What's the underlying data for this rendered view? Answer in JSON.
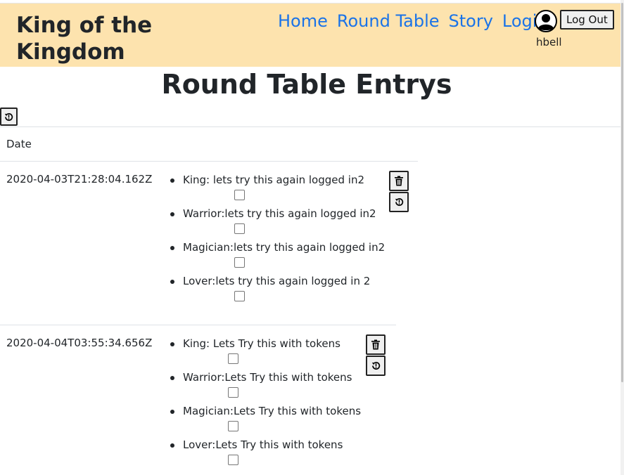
{
  "header": {
    "brand": "King of the Kingdom",
    "nav": [
      "Home",
      "Round Table",
      "Story",
      "Login"
    ],
    "logout_label": "Log Out",
    "username": "hbell"
  },
  "main": {
    "title": "Round Table Entrys",
    "date_column": "Date"
  },
  "entries": [
    {
      "date": "2020-04-03T21:28:04.162Z",
      "items": [
        "King: lets try this again logged in2",
        "Warrior:lets try this again logged in2",
        "Magician:lets try this again logged in2",
        "Lover:lets try this again logged in 2"
      ]
    },
    {
      "date": "2020-04-04T03:55:34.656Z",
      "items": [
        "King: Lets Try this with tokens",
        "Warrior:Lets Try this with tokens",
        "Magician:Lets Try this with tokens",
        "Lover:Lets Try this with tokens"
      ]
    }
  ],
  "icons": {
    "avatar": "user-circle-icon",
    "delete": "trash-icon",
    "history": "history-icon"
  }
}
